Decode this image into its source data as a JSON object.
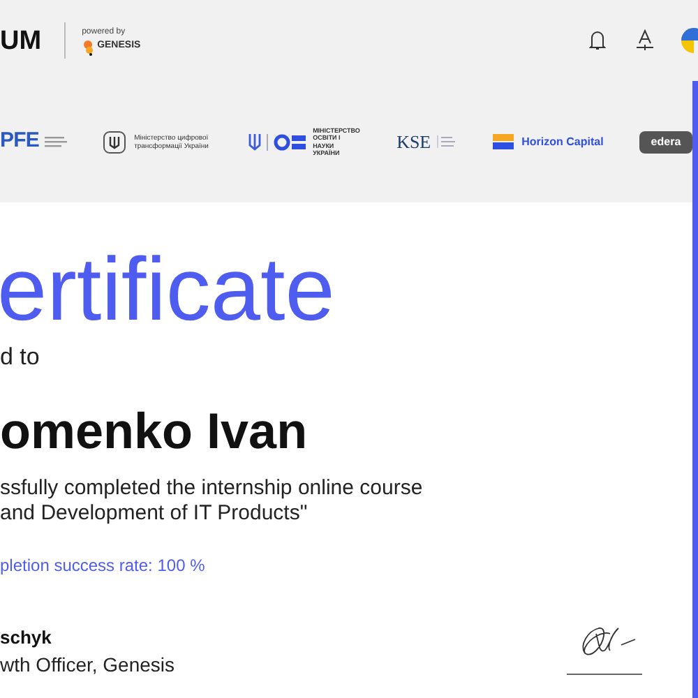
{
  "header": {
    "logo": "UM",
    "powered_by": "powered by",
    "partner": "GENESIS"
  },
  "partners": [
    {
      "kind": "pfe",
      "text": "PFE"
    },
    {
      "kind": "ministry",
      "text": "Міністерство цифрової трансформації України"
    },
    {
      "kind": "mon",
      "text": "МІНІСТЕРСТВО ОСВІТИ І НАУКИ УКРАЇНИ"
    },
    {
      "kind": "kse",
      "text": "KSE"
    },
    {
      "kind": "horizon",
      "text": "Horizon Capital"
    },
    {
      "kind": "edera",
      "text": "edera"
    }
  ],
  "certificate": {
    "title": "ertificate",
    "awarded": "d to",
    "name": "omenko Ivan",
    "body": [
      "ssfully completed the internship online course",
      "and Development of IT Products\""
    ],
    "rate": "pletion success rate: 100 %",
    "signer": "schyk",
    "signer_role": "wth Officer, Genesis"
  }
}
